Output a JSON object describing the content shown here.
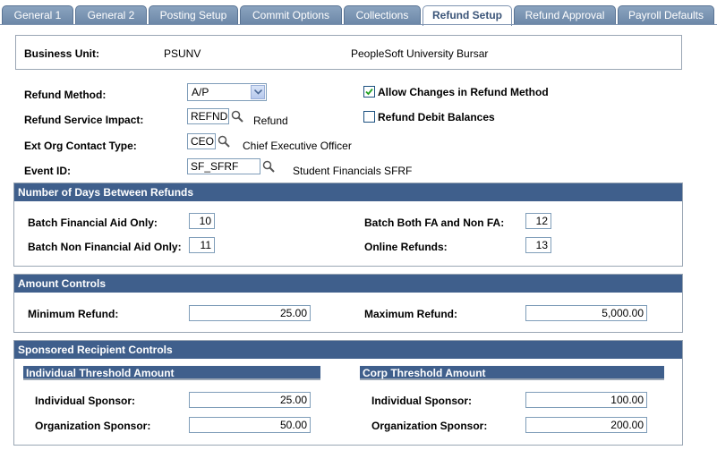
{
  "tabs": [
    {
      "label": "General 1"
    },
    {
      "label": "General 2"
    },
    {
      "label": "Posting Setup"
    },
    {
      "label": "Commit Options"
    },
    {
      "label": "Collections"
    },
    {
      "label": "Refund Setup",
      "active": true
    },
    {
      "label": "Refund Approval"
    },
    {
      "label": "Payroll Defaults"
    }
  ],
  "business_unit": {
    "label": "Business Unit:",
    "value": "PSUNV",
    "description": "PeopleSoft University Bursar"
  },
  "refund_method": {
    "label": "Refund Method:",
    "value": "A/P"
  },
  "allow_changes": {
    "label": "Allow Changes in Refund Method",
    "checked": true
  },
  "refund_debit": {
    "label": "Refund Debit Balances",
    "checked": false
  },
  "service_impact": {
    "label": "Refund Service Impact:",
    "value": "REFND",
    "description": "Refund"
  },
  "ext_org": {
    "label": "Ext Org Contact Type:",
    "value": "CEO",
    "description": "Chief Executive Officer"
  },
  "event_id": {
    "label": "Event ID:",
    "value": "SF_SFRF",
    "description": "Student Financials SFRF"
  },
  "days_between": {
    "title": "Number of Days Between Refunds",
    "batch_fa_only": {
      "label": "Batch Financial Aid Only:",
      "value": "10"
    },
    "batch_both": {
      "label": "Batch Both FA and Non FA:",
      "value": "12"
    },
    "batch_non_fa": {
      "label": "Batch Non Financial Aid Only:",
      "value": "11"
    },
    "online": {
      "label": "Online Refunds:",
      "value": "13"
    }
  },
  "amount_controls": {
    "title": "Amount Controls",
    "minimum": {
      "label": "Minimum Refund:",
      "value": "25.00"
    },
    "maximum": {
      "label": "Maximum Refund:",
      "value": "5,000.00"
    }
  },
  "sponsored": {
    "title": "Sponsored Recipient Controls",
    "individual": {
      "title": "Individual Threshold Amount",
      "individual_sponsor": {
        "label": "Individual Sponsor:",
        "value": "25.00"
      },
      "organization_sponsor": {
        "label": "Organization Sponsor:",
        "value": "50.00"
      }
    },
    "corp": {
      "title": "Corp Threshold Amount",
      "individual_sponsor": {
        "label": "Individual Sponsor:",
        "value": "100.00"
      },
      "organization_sponsor": {
        "label": "Organization Sponsor:",
        "value": "200.00"
      }
    }
  },
  "icons": {
    "lookup": "magnifier-icon",
    "dropdown": "chevron-down-icon",
    "check": "checkmark-icon"
  },
  "colors": {
    "header": "#3f5f8c",
    "tab": "#7a95b5",
    "border": "#9aa6b4"
  }
}
